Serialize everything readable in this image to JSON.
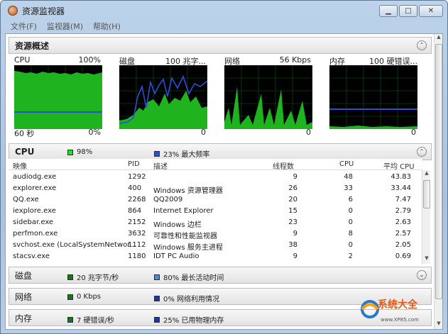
{
  "window": {
    "title": "资源监视器",
    "buttons": {
      "minimize": "▁",
      "maximize": "□",
      "close": "✕"
    }
  },
  "menu": [
    "文件(F)",
    "监视器(M)",
    "帮助(H)"
  ],
  "overview": {
    "title": "资源概述",
    "graphs": [
      {
        "name": "CPU",
        "max": "100%",
        "bottom_left": "60 秒",
        "bottom_right": "0%"
      },
      {
        "name": "磁盘",
        "max": "100 兆字...",
        "bottom_left": "",
        "bottom_right": "0"
      },
      {
        "name": "网络",
        "max": "56 Kbps",
        "bottom_left": "",
        "bottom_right": "0"
      },
      {
        "name": "内存",
        "max": "100 硬错误...",
        "bottom_left": "",
        "bottom_right": "0"
      }
    ]
  },
  "cpu": {
    "title": "CPU",
    "usage": "98%",
    "freq": "23% 最大频率",
    "columns": [
      "映像",
      "PID",
      "描述",
      "线程数",
      "CPU",
      "平均 CPU"
    ],
    "rows": [
      [
        "audiodg.exe",
        "1292",
        "",
        "9",
        "48",
        "43.83"
      ],
      [
        "explorer.exe",
        "400",
        "Windows 资源管理器",
        "26",
        "33",
        "33.44"
      ],
      [
        "QQ.exe",
        "2268",
        "QQ2009",
        "20",
        "6",
        "7.47"
      ],
      [
        "iexplore.exe",
        "864",
        "Internet Explorer",
        "15",
        "0",
        "2.79"
      ],
      [
        "sidebar.exe",
        "2152",
        "Windows 边栏",
        "23",
        "0",
        "2.63"
      ],
      [
        "perfmon.exe",
        "3632",
        "可靠性和性能监视器",
        "9",
        "8",
        "2.57"
      ],
      [
        "svchost.exe (LocalSystemNetwor...",
        "1112",
        "Windows 服务主进程",
        "38",
        "0",
        "2.05"
      ],
      [
        "stacsv.exe",
        "1180",
        "IDT PC Audio",
        "9",
        "2",
        "0.69"
      ]
    ]
  },
  "disk": {
    "title": "磁盘",
    "a": "20 兆字节/秒",
    "b": "80% 最长活动时间"
  },
  "network": {
    "title": "网络",
    "a": "0 Kbps",
    "b": "0% 网络利用情况"
  },
  "memory": {
    "title": "内存",
    "a": "7 硬错误/秒",
    "b": "25% 已用物理内存"
  },
  "watermark": {
    "text": "系统大全",
    "sub": "www.XP85.com"
  },
  "colors": {
    "green": "#1fe21f",
    "blue": "#2a4fd6",
    "plot_bg": "#000000",
    "grid": "#1b7a1b"
  }
}
